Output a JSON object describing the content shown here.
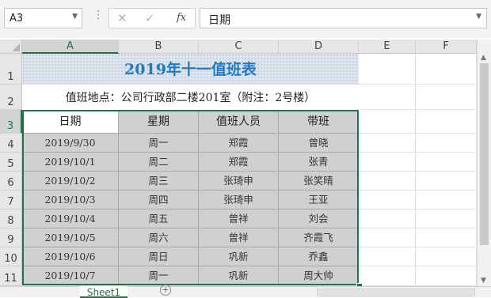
{
  "formula_bar": {
    "name_box": "A3",
    "cancel_icon": "✕",
    "enter_icon": "✓",
    "fx_label": "fx",
    "formula_value": "日期"
  },
  "grid": {
    "columns": [
      "A",
      "B",
      "C",
      "D",
      "E",
      "F"
    ],
    "rows": [
      "1",
      "2",
      "3",
      "4",
      "5",
      "6",
      "7",
      "8",
      "9",
      "10",
      "11"
    ]
  },
  "sheet": {
    "title": "2019年十一值班表",
    "subtitle": "值班地点：公司行政部二楼201室（附注：2号楼）",
    "headers": [
      "日期",
      "星期",
      "值班人员",
      "带班"
    ],
    "records": [
      [
        "2019/9/30",
        "周一",
        "郑霞",
        "曾晓"
      ],
      [
        "2019/10/1",
        "周二",
        "郑霞",
        "张青"
      ],
      [
        "2019/10/2",
        "周三",
        "张琦申",
        "张笑晴"
      ],
      [
        "2019/10/3",
        "周四",
        "张琦申",
        "王亚"
      ],
      [
        "2019/10/4",
        "周五",
        "曾祥",
        "刘会"
      ],
      [
        "2019/10/5",
        "周六",
        "曾祥",
        "齐霞飞"
      ],
      [
        "2019/10/6",
        "周日",
        "巩新",
        "乔鑫"
      ],
      [
        "2019/10/7",
        "周一",
        "巩新",
        "周大帅"
      ]
    ]
  },
  "tabs": {
    "active_sheet": "Sheet1",
    "add_sheet": "+"
  },
  "colors": {
    "accent": "#217346",
    "title_text": "#1f7bc1",
    "title_fill": "#dde4ee",
    "body_fill": "#d0d0d0"
  }
}
